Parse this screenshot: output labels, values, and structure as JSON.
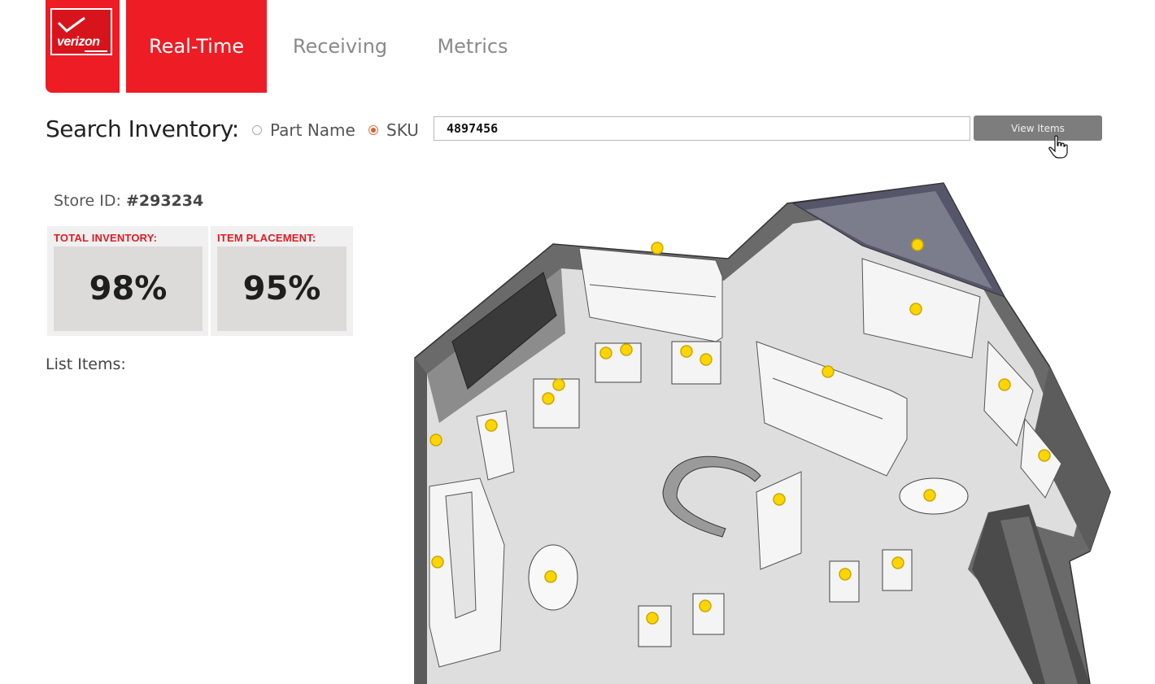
{
  "brand": {
    "logo_text": "verizon"
  },
  "nav": {
    "tabs": [
      {
        "label": "Real-Time",
        "active": true
      },
      {
        "label": "Receiving",
        "active": false
      },
      {
        "label": "Metrics",
        "active": false
      }
    ]
  },
  "search": {
    "title": "Search Inventory:",
    "options": [
      {
        "label": "Part Name",
        "selected": false
      },
      {
        "label": "SKU",
        "selected": true
      }
    ],
    "value": "4897456",
    "button_label": "View Items"
  },
  "store": {
    "id_label": "Store ID:",
    "id_value": "#293234"
  },
  "stats": {
    "total_inventory": {
      "label": "TOTAL INVENTORY:",
      "value": "98%"
    },
    "item_placement": {
      "label": "ITEM PLACEMENT:",
      "value": "95%"
    }
  },
  "list": {
    "title": "List Items:"
  },
  "colors": {
    "brand_red": "#ee1c25",
    "pin_yellow": "#ffd500",
    "button_gray": "#7d7d7d"
  },
  "icons": {
    "cursor": "hand-pointer-icon",
    "pin": "location-pin-icon"
  },
  "map": {
    "pin_count": 24
  }
}
